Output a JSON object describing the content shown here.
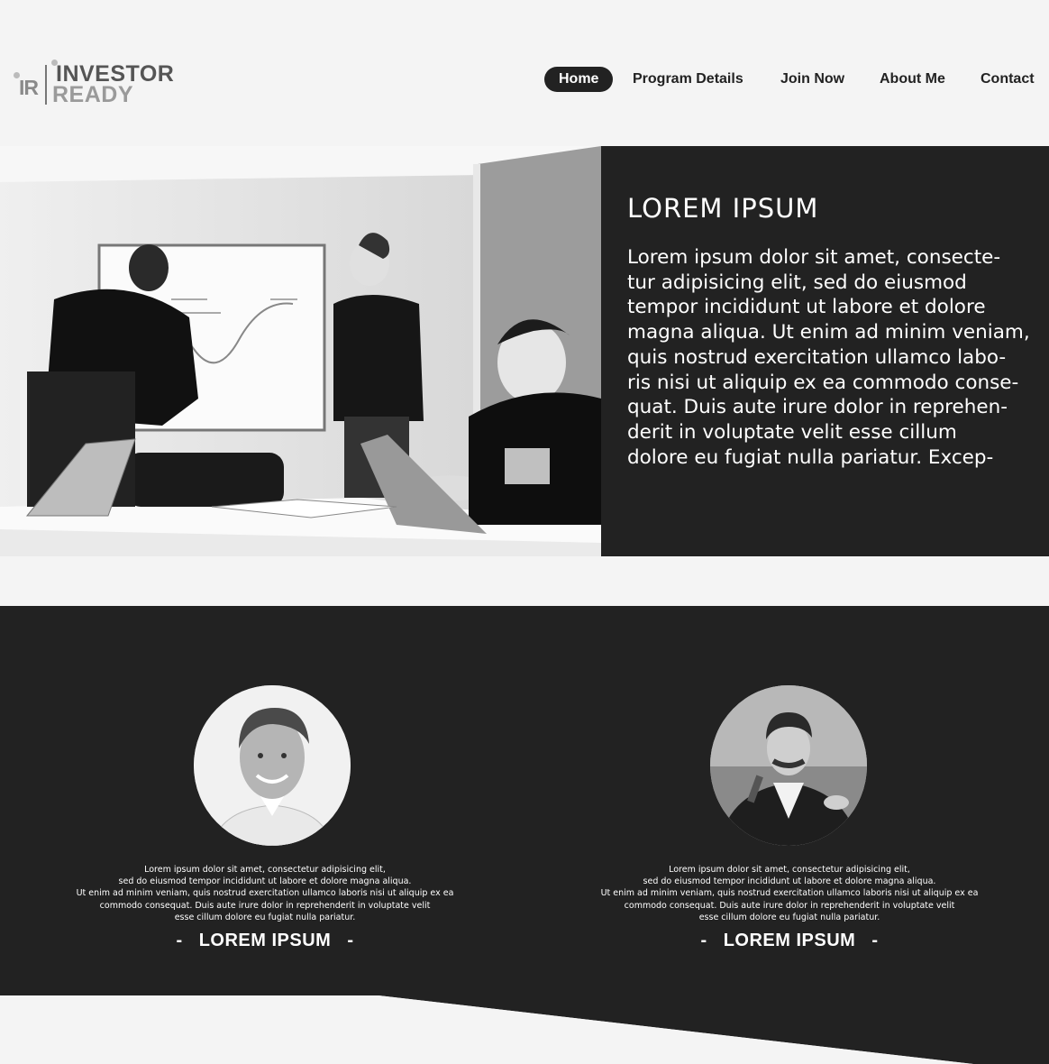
{
  "brand": {
    "monogram": "IR",
    "line1": "INVESTOR",
    "line2": "READY"
  },
  "nav": {
    "items": [
      {
        "label": "Home",
        "active": true
      },
      {
        "label": "Program Details",
        "active": false
      },
      {
        "label": "Join Now",
        "active": false
      },
      {
        "label": "About Me",
        "active": false
      },
      {
        "label": "Contact",
        "active": false
      }
    ]
  },
  "hero": {
    "title": "LOREM IPSUM",
    "body_lines": [
      "Lorem ipsum dolor sit amet, consecte-",
      "tur adipisicing elit, sed do eiusmod",
      "tempor incididunt ut labore et dolore",
      "magna aliqua. Ut enim ad minim veniam,",
      "quis nostrud exercitation ullamco labo-",
      "ris nisi ut aliquip ex ea commodo conse-",
      "quat. Duis aute irure dolor in reprehen-",
      "derit in voluptate velit esse cillum",
      "dolore eu fugiat nulla pariatur. Excep-"
    ],
    "photo_icon": "team-meeting-photo"
  },
  "team": {
    "members": [
      {
        "bio_lines": [
          "Lorem ipsum dolor sit amet, consectetur adipisicing elit,",
          "sed do eiusmod tempor incididunt ut labore et dolore magna aliqua.",
          "Ut enim ad minim veniam,  quis nostrud exercitation ullamco laboris nisi ut aliquip ex ea",
          "commodo consequat.  Duis aute irure dolor in reprehenderit in voluptate velit",
          "esse cillum dolore eu fugiat nulla pariatur."
        ],
        "name": "LOREM IPSUM",
        "dash": "-"
      },
      {
        "bio_lines": [
          "Lorem ipsum dolor sit amet, consectetur adipisicing elit,",
          "sed do eiusmod tempor incididunt ut labore et dolore magna aliqua.",
          "Ut enim ad minim veniam,  quis nostrud exercitation ullamco laboris nisi ut aliquip ex ea",
          "commodo consequat.  Duis aute irure dolor in reprehenderit in voluptate velit",
          "esse cillum dolore eu fugiat nulla pariatur."
        ],
        "name": "LOREM IPSUM",
        "dash": "-"
      }
    ]
  },
  "colors": {
    "dark": "#222222",
    "light": "#f4f4f4",
    "accent_text": "#ffffff"
  }
}
